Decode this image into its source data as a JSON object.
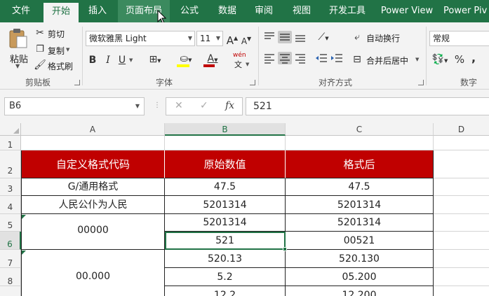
{
  "tabs": [
    {
      "label": "文件"
    },
    {
      "label": "开始"
    },
    {
      "label": "插入"
    },
    {
      "label": "页面布局"
    },
    {
      "label": "公式"
    },
    {
      "label": "数据"
    },
    {
      "label": "审阅"
    },
    {
      "label": "视图"
    },
    {
      "label": "开发工具"
    },
    {
      "label": "Power View"
    },
    {
      "label": "Power Piv"
    }
  ],
  "clipboard": {
    "group": "剪贴板",
    "paste": "粘贴",
    "cut": "剪切",
    "copy": "复制",
    "format_painter": "格式刷"
  },
  "font": {
    "group": "字体",
    "name": "微软雅黑 Light",
    "size": "11",
    "grow": "A",
    "shrink": "A",
    "bold": "B",
    "italic": "I",
    "underline": "U",
    "font_color_glyph": "A",
    "font_color": "#c00000",
    "fill_color": "#ffff00",
    "phonetic_top": "wén",
    "phonetic_bottom": "文"
  },
  "alignment": {
    "group": "对齐方式",
    "wrap_text": "自动换行",
    "merge_center": "合并后居中"
  },
  "number": {
    "group": "数字",
    "format": "常规",
    "percent": "%",
    "comma": ","
  },
  "formula_bar": {
    "name_box": "B6",
    "cancel": "✕",
    "enter": "✓",
    "fx": "fx",
    "content": "521"
  },
  "columns": [
    "A",
    "B",
    "C",
    "D"
  ],
  "rows": [
    "1",
    "2",
    "3",
    "4",
    "5",
    "6",
    "7",
    "8"
  ],
  "table": {
    "header": [
      "自定义格式代码",
      "原始数值",
      "格式后"
    ],
    "header_color": "#c00000",
    "r3": [
      "G/通用格式",
      "47.5",
      "47.5"
    ],
    "r4": [
      "人民公仆为人民",
      "5201314",
      "5201314"
    ],
    "r5": [
      "00000",
      "5201314",
      "5201314"
    ],
    "r6": [
      "521",
      "00521"
    ],
    "r7": [
      "00.000",
      "520.13",
      "520.130"
    ],
    "r8": [
      "5.2",
      "05.200"
    ],
    "r9": [
      "12.2",
      "12.200"
    ]
  },
  "accent_color": "#217346"
}
